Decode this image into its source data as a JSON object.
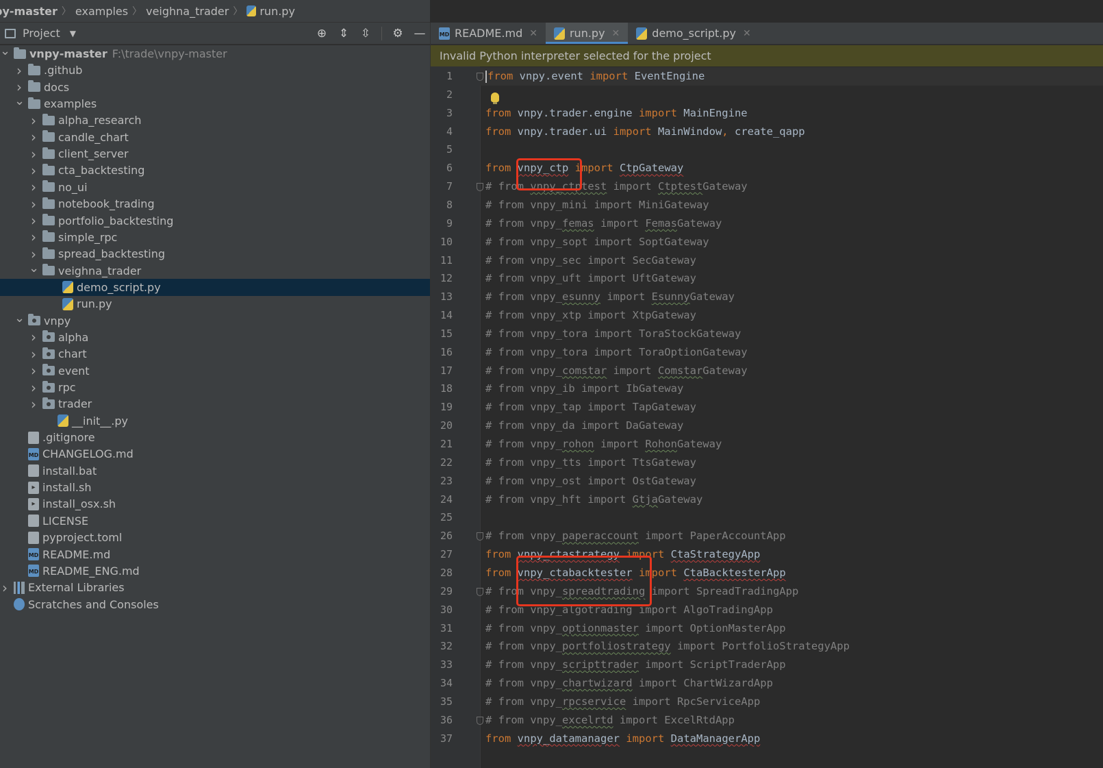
{
  "breadcrumb": [
    "py-master",
    "examples",
    "veighna_trader",
    "run.py"
  ],
  "project_panel": {
    "title": "Project",
    "icons": [
      "locate-icon",
      "expand-all-icon",
      "collapse-all-icon",
      "gear-icon",
      "minimize-icon"
    ]
  },
  "tree": [
    {
      "label": "vnpy-master",
      "path": "F:\\trade\\vnpy-master",
      "kind": "folder",
      "indent": 0,
      "chev": "down",
      "bold": true
    },
    {
      "label": ".github",
      "kind": "folder",
      "indent": 1,
      "chev": "right"
    },
    {
      "label": "docs",
      "kind": "folder",
      "indent": 1,
      "chev": "right"
    },
    {
      "label": "examples",
      "kind": "folder",
      "indent": 1,
      "chev": "down"
    },
    {
      "label": "alpha_research",
      "kind": "folder",
      "indent": 2,
      "chev": "right"
    },
    {
      "label": "candle_chart",
      "kind": "folder",
      "indent": 2,
      "chev": "right"
    },
    {
      "label": "client_server",
      "kind": "folder",
      "indent": 2,
      "chev": "right"
    },
    {
      "label": "cta_backtesting",
      "kind": "folder",
      "indent": 2,
      "chev": "right"
    },
    {
      "label": "no_ui",
      "kind": "folder",
      "indent": 2,
      "chev": "right"
    },
    {
      "label": "notebook_trading",
      "kind": "folder",
      "indent": 2,
      "chev": "right"
    },
    {
      "label": "portfolio_backtesting",
      "kind": "folder",
      "indent": 2,
      "chev": "right"
    },
    {
      "label": "simple_rpc",
      "kind": "folder",
      "indent": 2,
      "chev": "right"
    },
    {
      "label": "spread_backtesting",
      "kind": "folder",
      "indent": 2,
      "chev": "right"
    },
    {
      "label": "veighna_trader",
      "kind": "folder",
      "indent": 2,
      "chev": "down"
    },
    {
      "label": "demo_script.py",
      "kind": "py",
      "indent": 3,
      "chev": "",
      "selected": true
    },
    {
      "label": "run.py",
      "kind": "py",
      "indent": 3,
      "chev": ""
    },
    {
      "label": "vnpy",
      "kind": "pkg",
      "indent": 1,
      "chev": "down"
    },
    {
      "label": "alpha",
      "kind": "pkg",
      "indent": 2,
      "chev": "right"
    },
    {
      "label": "chart",
      "kind": "pkg",
      "indent": 2,
      "chev": "right"
    },
    {
      "label": "event",
      "kind": "pkg",
      "indent": 2,
      "chev": "right"
    },
    {
      "label": "rpc",
      "kind": "pkg",
      "indent": 2,
      "chev": "right"
    },
    {
      "label": "trader",
      "kind": "pkg",
      "indent": 2,
      "chev": "right"
    },
    {
      "label": "__init__.py",
      "kind": "py",
      "indent": 2,
      "chev": ""
    },
    {
      "label": ".gitignore",
      "kind": "git",
      "indent": 1,
      "chev": ""
    },
    {
      "label": "CHANGELOG.md",
      "kind": "md",
      "indent": 1,
      "chev": ""
    },
    {
      "label": "install.bat",
      "kind": "doc",
      "indent": 1,
      "chev": ""
    },
    {
      "label": "install.sh",
      "kind": "sh",
      "indent": 1,
      "chev": ""
    },
    {
      "label": "install_osx.sh",
      "kind": "sh",
      "indent": 1,
      "chev": ""
    },
    {
      "label": "LICENSE",
      "kind": "doc",
      "indent": 1,
      "chev": ""
    },
    {
      "label": "pyproject.toml",
      "kind": "doc",
      "indent": 1,
      "chev": ""
    },
    {
      "label": "README.md",
      "kind": "md",
      "indent": 1,
      "chev": ""
    },
    {
      "label": "README_ENG.md",
      "kind": "md",
      "indent": 1,
      "chev": ""
    },
    {
      "label": "External Libraries",
      "kind": "lib",
      "indent": 0,
      "chev": "right"
    },
    {
      "label": "Scratches and Consoles",
      "kind": "scratch",
      "indent": 0,
      "chev": ""
    }
  ],
  "tabs": [
    {
      "label": "README.md",
      "kind": "md",
      "active": false
    },
    {
      "label": "run.py",
      "kind": "py",
      "active": true
    },
    {
      "label": "demo_script.py",
      "kind": "py",
      "active": false
    }
  ],
  "banner": "Invalid Python interpreter selected for the project",
  "code": [
    {
      "n": "1",
      "tokens": [
        [
          "kw",
          "from"
        ],
        [
          "id",
          " vnpy.event "
        ],
        [
          "kw",
          "import"
        ],
        [
          "id",
          " EventEngine"
        ]
      ],
      "current": true,
      "fold": true
    },
    {
      "n": "2",
      "tokens": []
    },
    {
      "n": "3",
      "tokens": [
        [
          "kw",
          "from"
        ],
        [
          "id",
          " vnpy.trader.engine "
        ],
        [
          "kw",
          "import"
        ],
        [
          "id",
          " MainEngine"
        ]
      ]
    },
    {
      "n": "4",
      "tokens": [
        [
          "kw",
          "from"
        ],
        [
          "id",
          " vnpy.trader.ui "
        ],
        [
          "kw",
          "import"
        ],
        [
          "id",
          " MainWindow"
        ],
        [
          "kw",
          ","
        ],
        [
          "id",
          " create_qapp"
        ]
      ]
    },
    {
      "n": "5",
      "tokens": []
    },
    {
      "n": "6",
      "tokens": [
        [
          "kw",
          "from"
        ],
        [
          "id",
          " "
        ],
        [
          "idsq",
          "vnpy_ctp"
        ],
        [
          "id",
          " "
        ],
        [
          "kw",
          "import"
        ],
        [
          "id",
          " "
        ],
        [
          "idsq",
          "CtpGateway"
        ]
      ]
    },
    {
      "n": "7",
      "tokens": [
        [
          "cm",
          "# from "
        ],
        [
          "cmsq",
          "vnpy_ctptest"
        ],
        [
          "cm",
          " import "
        ],
        [
          "cmsq",
          "Ctptest"
        ],
        [
          "cm",
          "Gateway"
        ]
      ],
      "fold": true
    },
    {
      "n": "8",
      "tokens": [
        [
          "cm",
          "# from vnpy_mini import MiniGateway"
        ]
      ]
    },
    {
      "n": "9",
      "tokens": [
        [
          "cm",
          "# from vnpy_"
        ],
        [
          "cmsq",
          "femas"
        ],
        [
          "cm",
          " import "
        ],
        [
          "cmsq",
          "Femas"
        ],
        [
          "cm",
          "Gateway"
        ]
      ]
    },
    {
      "n": "10",
      "tokens": [
        [
          "cm",
          "# from vnpy_sopt import SoptGateway"
        ]
      ]
    },
    {
      "n": "11",
      "tokens": [
        [
          "cm",
          "# from vnpy_sec import SecGateway"
        ]
      ]
    },
    {
      "n": "12",
      "tokens": [
        [
          "cm",
          "# from vnpy_uft import UftGateway"
        ]
      ]
    },
    {
      "n": "13",
      "tokens": [
        [
          "cm",
          "# from vnpy_"
        ],
        [
          "cmsq",
          "esunny"
        ],
        [
          "cm",
          " import "
        ],
        [
          "cmsq",
          "Esunny"
        ],
        [
          "cm",
          "Gateway"
        ]
      ]
    },
    {
      "n": "14",
      "tokens": [
        [
          "cm",
          "# from vnpy_xtp import XtpGateway"
        ]
      ]
    },
    {
      "n": "15",
      "tokens": [
        [
          "cm",
          "# from vnpy_tora import ToraStockGateway"
        ]
      ]
    },
    {
      "n": "16",
      "tokens": [
        [
          "cm",
          "# from vnpy_tora import ToraOptionGateway"
        ]
      ]
    },
    {
      "n": "17",
      "tokens": [
        [
          "cm",
          "# from vnpy_"
        ],
        [
          "cmsq",
          "comstar"
        ],
        [
          "cm",
          " import "
        ],
        [
          "cmsq",
          "Comstar"
        ],
        [
          "cm",
          "Gateway"
        ]
      ]
    },
    {
      "n": "18",
      "tokens": [
        [
          "cm",
          "# from vnpy_ib import IbGateway"
        ]
      ]
    },
    {
      "n": "19",
      "tokens": [
        [
          "cm",
          "# from vnpy_tap import TapGateway"
        ]
      ]
    },
    {
      "n": "20",
      "tokens": [
        [
          "cm",
          "# from vnpy_da import DaGateway"
        ]
      ]
    },
    {
      "n": "21",
      "tokens": [
        [
          "cm",
          "# from vnpy_"
        ],
        [
          "cmsq",
          "rohon"
        ],
        [
          "cm",
          " import "
        ],
        [
          "cmsq",
          "Rohon"
        ],
        [
          "cm",
          "Gateway"
        ]
      ]
    },
    {
      "n": "22",
      "tokens": [
        [
          "cm",
          "# from vnpy_tts import TtsGateway"
        ]
      ]
    },
    {
      "n": "23",
      "tokens": [
        [
          "cm",
          "# from vnpy_ost import OstGateway"
        ]
      ]
    },
    {
      "n": "24",
      "tokens": [
        [
          "cm",
          "# from vnpy_hft import "
        ],
        [
          "cmsq",
          "Gtja"
        ],
        [
          "cm",
          "Gateway"
        ]
      ]
    },
    {
      "n": "25",
      "tokens": []
    },
    {
      "n": "26",
      "tokens": [
        [
          "cm",
          "# from vnpy_"
        ],
        [
          "cmsq",
          "paperaccount"
        ],
        [
          "cm",
          " import PaperAccountApp"
        ]
      ],
      "fold": true
    },
    {
      "n": "27",
      "tokens": [
        [
          "kw",
          "from"
        ],
        [
          "id",
          " "
        ],
        [
          "idsq",
          "vnpy_ctastrategy"
        ],
        [
          "id",
          " "
        ],
        [
          "kw",
          "import"
        ],
        [
          "id",
          " "
        ],
        [
          "idsq",
          "CtaStrategyApp"
        ]
      ]
    },
    {
      "n": "28",
      "tokens": [
        [
          "kw",
          "from"
        ],
        [
          "id",
          " "
        ],
        [
          "idsq",
          "vnpy_ctabacktester"
        ],
        [
          "id",
          " "
        ],
        [
          "kw",
          "import"
        ],
        [
          "id",
          " "
        ],
        [
          "idsq",
          "CtaBacktesterApp"
        ]
      ]
    },
    {
      "n": "29",
      "tokens": [
        [
          "cm",
          "# from vnpy_"
        ],
        [
          "cmsq",
          "spreadtrading"
        ],
        [
          "cm",
          " import SpreadTradingApp"
        ]
      ],
      "fold": true
    },
    {
      "n": "30",
      "tokens": [
        [
          "cm",
          "# from vnpy_algotrading import AlgoTradingApp"
        ]
      ]
    },
    {
      "n": "31",
      "tokens": [
        [
          "cm",
          "# from vnpy_"
        ],
        [
          "cmsq",
          "optionmaster"
        ],
        [
          "cm",
          " import OptionMasterApp"
        ]
      ]
    },
    {
      "n": "32",
      "tokens": [
        [
          "cm",
          "# from vnpy_"
        ],
        [
          "cmsq",
          "portfoliostrategy"
        ],
        [
          "cm",
          " import PortfolioStrategyApp"
        ]
      ]
    },
    {
      "n": "33",
      "tokens": [
        [
          "cm",
          "# from vnpy_"
        ],
        [
          "cmsq",
          "scripttrader"
        ],
        [
          "cm",
          " import ScriptTraderApp"
        ]
      ]
    },
    {
      "n": "34",
      "tokens": [
        [
          "cm",
          "# from vnpy_"
        ],
        [
          "cmsq",
          "chartwizard"
        ],
        [
          "cm",
          " import ChartWizardApp"
        ]
      ]
    },
    {
      "n": "35",
      "tokens": [
        [
          "cm",
          "# from vnpy_"
        ],
        [
          "cmsq",
          "rpcservice"
        ],
        [
          "cm",
          " import RpcServiceApp"
        ]
      ]
    },
    {
      "n": "36",
      "tokens": [
        [
          "cm",
          "# from vnpy_"
        ],
        [
          "cmsq",
          "excelrtd"
        ],
        [
          "cm",
          " import ExcelRtdApp"
        ]
      ],
      "fold": true
    },
    {
      "n": "37",
      "tokens": [
        [
          "kw",
          "from"
        ],
        [
          "id",
          " "
        ],
        [
          "idsq",
          "vnpy_datamanager"
        ],
        [
          "id",
          " "
        ],
        [
          "kw",
          "import"
        ],
        [
          "id",
          " "
        ],
        [
          "idsq",
          "DataManagerApp"
        ]
      ]
    }
  ],
  "colors": {
    "accent": "#4a88c7",
    "highlight_box": "#e6361f",
    "banner_bg": "#4b4a23"
  }
}
